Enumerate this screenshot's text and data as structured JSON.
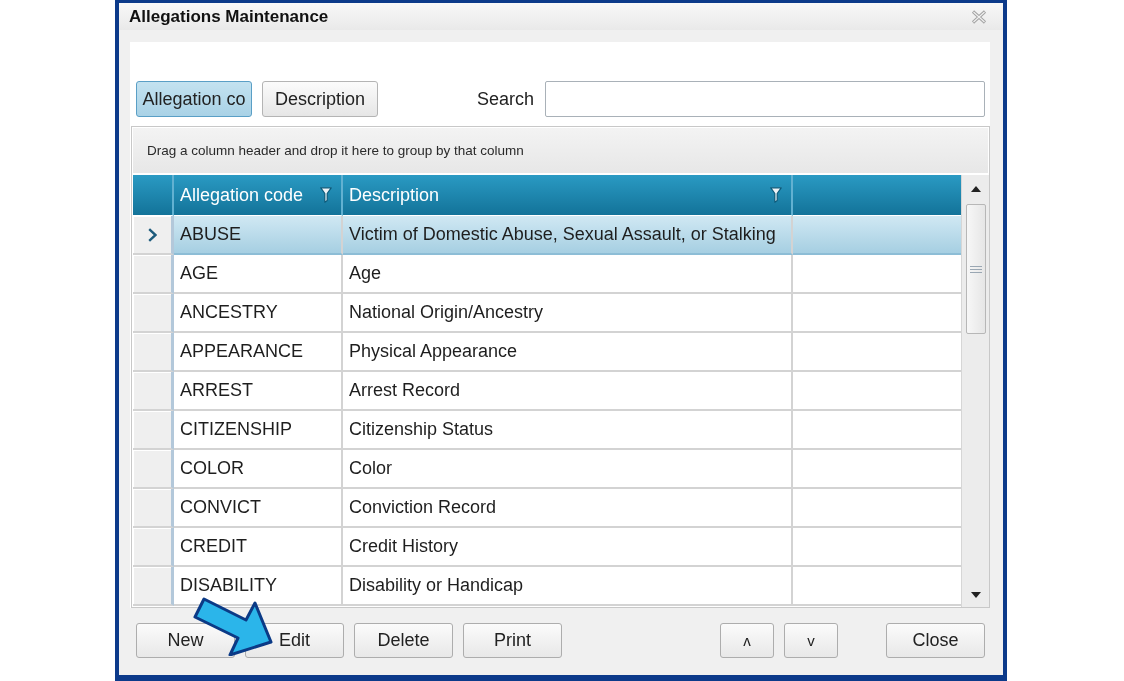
{
  "window": {
    "title": "Allegations Maintenance"
  },
  "search_by": [
    {
      "label": "Allegation co",
      "selected": true
    },
    {
      "label": "Description",
      "selected": false
    }
  ],
  "search": {
    "label": "Search"
  },
  "grid": {
    "group_panel_hint": "Drag a column header and drop it here to group by that column",
    "columns": [
      {
        "label": "Allegation code"
      },
      {
        "label": "Description"
      }
    ],
    "rows": [
      {
        "code": "ABUSE",
        "description": "Victim of Domestic Abuse, Sexual Assault, or Stalking",
        "selected": true
      },
      {
        "code": "AGE",
        "description": "Age",
        "selected": false
      },
      {
        "code": "ANCESTRY",
        "description": "National Origin/Ancestry",
        "selected": false
      },
      {
        "code": "APPEARANCE",
        "description": "Physical Appearance",
        "selected": false
      },
      {
        "code": "ARREST",
        "description": "Arrest Record",
        "selected": false
      },
      {
        "code": "CITIZENSHIP",
        "description": "Citizenship Status",
        "selected": false
      },
      {
        "code": "COLOR",
        "description": "Color",
        "selected": false
      },
      {
        "code": "CONVICT",
        "description": "Conviction Record",
        "selected": false
      },
      {
        "code": "CREDIT",
        "description": "Credit History",
        "selected": false
      },
      {
        "code": "DISABILITY",
        "description": "Disability or Handicap",
        "selected": false
      }
    ]
  },
  "buttons": [
    "New",
    "Edit",
    "Delete",
    "Print"
  ],
  "order_buttons": [
    "ʌ",
    "v"
  ],
  "close_button": "Close"
}
